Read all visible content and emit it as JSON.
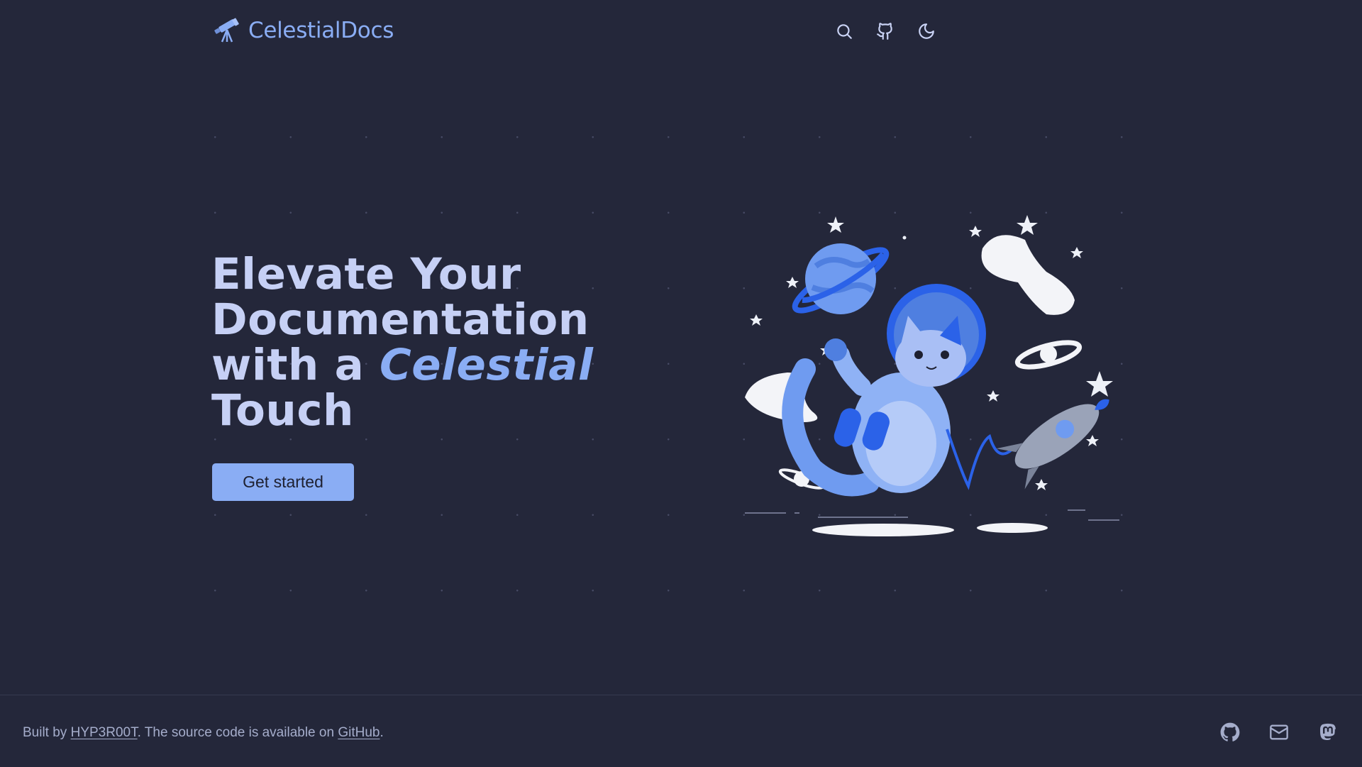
{
  "header": {
    "site_title": "CelestialDocs",
    "logo_icon": "telescope-icon",
    "actions": [
      {
        "icon": "search-icon"
      },
      {
        "icon": "github-icon"
      },
      {
        "icon": "moon-icon"
      }
    ]
  },
  "hero": {
    "line1": "Elevate Your",
    "line2": "Documentation",
    "line3_prefix": "with a ",
    "line3_accent": "Celestial",
    "line4": "Touch",
    "cta_label": "Get started",
    "illustration": "astronaut-cat-illustration"
  },
  "footer": {
    "prefix": "Built by ",
    "author_link": "HYP3R00T",
    "middle": ". The source code is available on ",
    "source_link": "GitHub",
    "suffix": ".",
    "social": [
      {
        "icon": "github-icon"
      },
      {
        "icon": "mail-icon"
      },
      {
        "icon": "mastodon-icon"
      }
    ]
  },
  "colors": {
    "background": "#24273a",
    "accent": "#8aadf4",
    "heading": "#c6d0f5",
    "muted_text": "#a5adcb"
  }
}
